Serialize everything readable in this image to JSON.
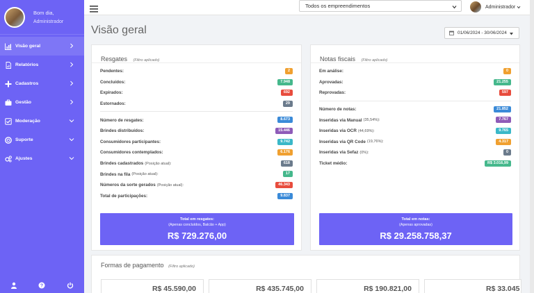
{
  "sidebar": {
    "greeting": "Bom dia,",
    "user": "Administrador",
    "items": [
      {
        "label": "Visão geral",
        "icon": "chart-icon",
        "active": true
      },
      {
        "label": "Relatórios",
        "icon": "report-icon"
      },
      {
        "label": "Cadastros",
        "icon": "plus-icon"
      },
      {
        "label": "Gestão",
        "icon": "briefcase-icon"
      },
      {
        "label": "Moderação",
        "icon": "check-square-icon"
      },
      {
        "label": "Suporte",
        "icon": "lifebuoy-icon"
      },
      {
        "label": "Ajustes",
        "icon": "gears-icon"
      }
    ],
    "footer_icons": [
      "user-icon",
      "help-icon",
      "power-icon"
    ]
  },
  "topbar": {
    "select_value": "Todos os empreendimentos",
    "user": "Administrador"
  },
  "page": {
    "title": "Visão geral",
    "date_range": "01/06/2024 - 30/06/2024"
  },
  "colors": {
    "primary": "#6d63f5",
    "orange": "#f0a030",
    "green": "#45b88c",
    "red": "#e84c3d",
    "gray": "#6b7b8c",
    "blue": "#3a8ad8",
    "purple": "#8e5bb8",
    "cyan": "#3ab8c8"
  },
  "resgates": {
    "title": "Resgates",
    "filter": "(Filtro aplicado)",
    "status_rows": [
      {
        "label": "Pendentes:",
        "value": "2",
        "color": "#f0a030"
      },
      {
        "label": "Concluídos:",
        "value": "7.948",
        "color": "#45b88c"
      },
      {
        "label": "Expirados:",
        "value": "692",
        "color": "#e84c3d"
      },
      {
        "label": "Estornados:",
        "value": "29",
        "color": "#6b7b8c"
      }
    ],
    "metric_rows": [
      {
        "label": "Número de resgates:",
        "note": "",
        "value": "8.673",
        "color": "#3a8ad8"
      },
      {
        "label": "Brindes distribuídos:",
        "note": "",
        "value": "15.446",
        "color": "#8e5bb8"
      },
      {
        "label": "Consumidores participantes:",
        "note": "",
        "value": "9.742",
        "color": "#3ab8c8"
      },
      {
        "label": "Consumidores contemplados:",
        "note": "",
        "value": "6.176",
        "color": "#f0a030"
      },
      {
        "label": "Brindes cadastrados",
        "note": "(Posição atual):",
        "value": "618",
        "color": "#6b7b8c"
      },
      {
        "label": "Brindes na fila",
        "note": "(Posição atual):",
        "value": "17",
        "color": "#45b88c"
      },
      {
        "label": "Números da sorte gerados",
        "note": "(Posição atual):",
        "value": "46.343",
        "color": "#e84c3d"
      },
      {
        "label": "Total de participações:",
        "note": "",
        "value": "9.837",
        "color": "#3a8ad8"
      }
    ],
    "total_label": "Total em resgates:",
    "total_note": "(Apenas concluídos, Balcão + App)",
    "total_value": "R$ 729.276,00"
  },
  "notas": {
    "title": "Notas fiscais",
    "filter": "(Filtro aplicado)",
    "status_rows": [
      {
        "label": "Em análise:",
        "value": "0",
        "color": "#f0a030"
      },
      {
        "label": "Aprovadas:",
        "value": "21.255",
        "color": "#45b88c"
      },
      {
        "label": "Reprovadas:",
        "value": "597",
        "color": "#e84c3d"
      }
    ],
    "metric_rows": [
      {
        "label": "Número de notas:",
        "note": "",
        "value": "21.852",
        "color": "#3a8ad8"
      },
      {
        "label": "Inseridas via Manual",
        "note": "(35,54%):",
        "value": "7.767",
        "color": "#8e5bb8"
      },
      {
        "label": "Inseridas via OCR",
        "note": "(44,69%):",
        "value": "9.765",
        "color": "#3ab8c8"
      },
      {
        "label": "Inseridas via QR Code",
        "note": "(19,76%):",
        "value": "4.317",
        "color": "#f0a030"
      },
      {
        "label": "Inseridas via Sefaz",
        "note": "(0%):",
        "value": "0",
        "color": "#6b7b8c"
      },
      {
        "label": "Ticket médio:",
        "note": "",
        "value": "R$ 3.016,99",
        "color": "#45b88c"
      }
    ],
    "total_label": "Total em notas:",
    "total_note": "(Apenas aprovadas)",
    "total_value": "R$ 29.258.758,37"
  },
  "pagamento": {
    "title": "Formas de pagamento",
    "filter": "(Filtro aplicado)",
    "values": [
      "R$ 45.590,00",
      "R$ 435.745,00",
      "R$ 190.821,00",
      "R$ 33.045"
    ]
  }
}
